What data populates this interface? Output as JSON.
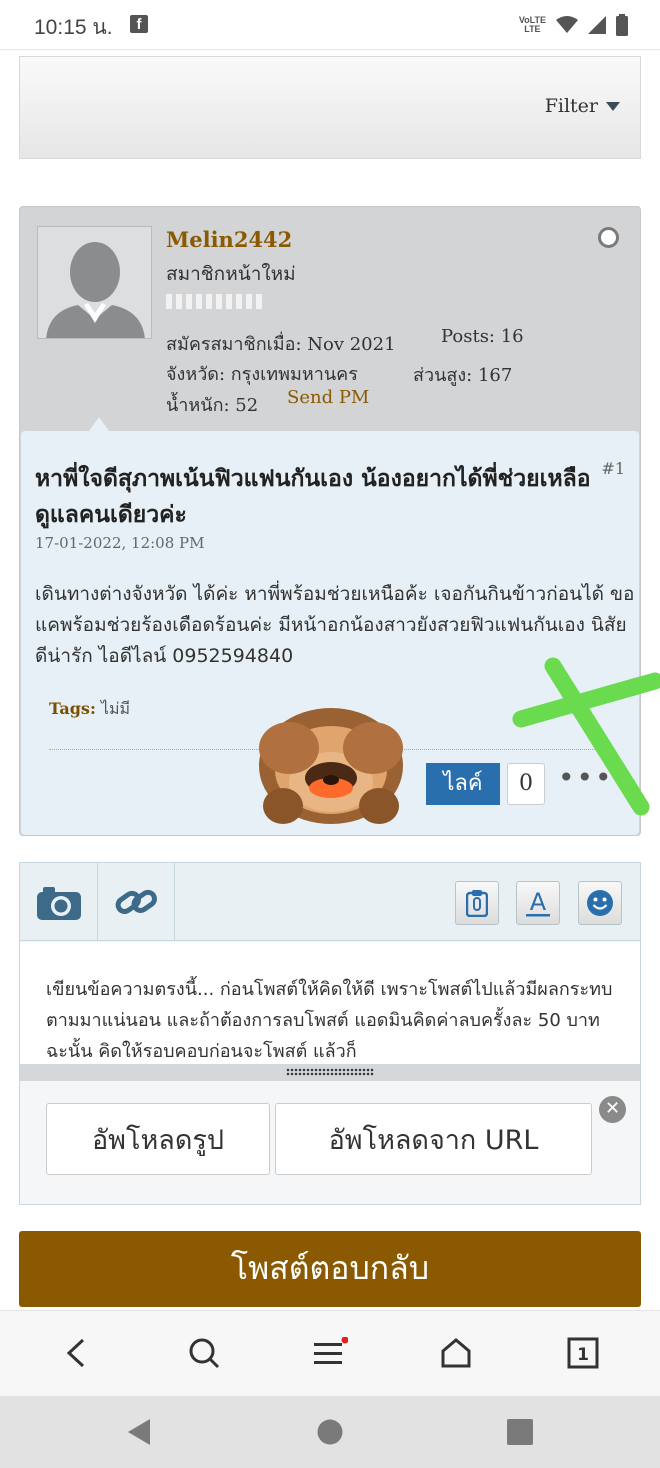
{
  "status_bar": {
    "time": "10:15 น.",
    "app_icon": "facebook-icon",
    "lte_line1": "VoLTE",
    "lte_line2": "LTE",
    "icons": [
      "volte-icon",
      "wifi-icon",
      "signal-icon",
      "battery-icon"
    ]
  },
  "filter": {
    "label": "Filter"
  },
  "post": {
    "username": "Melin2442",
    "rank": "สมาชิกหน้าใหม่",
    "joined": "สมัครสมาชิกเมื่อ: Nov 2021",
    "posts": "Posts: 16",
    "province": "จังหวัด: กรุงเทพมหานคร",
    "height": "ส่วนสูง: 167",
    "weight": "น้ำหนัก: 52",
    "send_pm": "Send PM",
    "title": "หาพี่ใจดีสุภาพเน้นฟิวแฟนกันเอง น้องอยากได้พี่ช่วยเหลือดูแลคนเดียวค่ะ",
    "number": "#1",
    "date": "17-01-2022, 12:08 PM",
    "body": "เดินทางต่างจังหวัด ได้ค่ะ หาพี่พร้อมช่วยเหนือค้ะ เจอกันกินข้าวก่อนได้ ขอแคพร้อมช่วยร้องเดือดร้อนค่ะ มีหน้าอกน้องสาวยังสวยฟิวแฟนกันเอง นิสัยดีน่ารัก ไอดีไลน์ 0952594840",
    "tags_label": "Tags:",
    "tags_value": "ไม่มี",
    "like_label": "ไลค์",
    "like_count": "0",
    "more": "•••"
  },
  "editor": {
    "text": "เขียนข้อความตรงนี้... ก่อนโพสต์ให้คิดให้ดี เพราะโพสต์ไปแล้วมีผลกระทบตามมาแน่นอน และถ้าต้องการลบโพสต์ แอดมินคิดค่าลบครั้งละ 50 บาท ฉะนั้น คิดให้รอบคอบก่อนจะโพสต์ แล้วก็",
    "upload_image": "อัพโหลดรูป",
    "upload_url": "อัพโหลดจาก URL",
    "close": "✕"
  },
  "reply_button": "โพสต์ตอบกลับ",
  "colors": {
    "brand_brown": "#8b5a00",
    "like_blue": "#2a6fad",
    "message_bg": "#e6f0f6",
    "profile_bg": "#d2d4d6",
    "scribble_green": "#6ada4e"
  }
}
